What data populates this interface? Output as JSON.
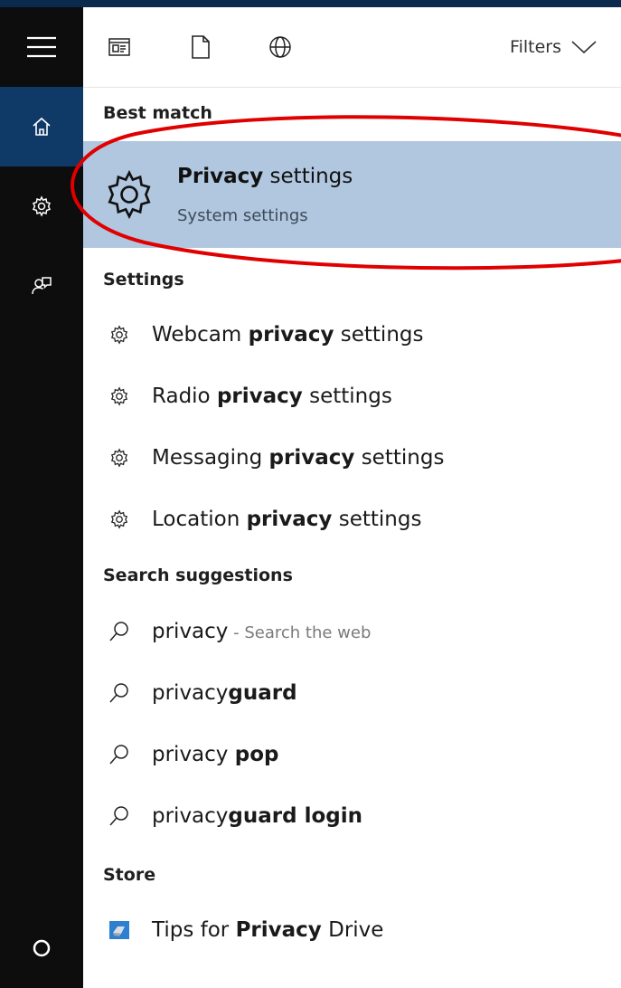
{
  "toolbar": {
    "filters_label": "Filters",
    "tab_icons": [
      "apps-icon",
      "document-icon",
      "web-globe-icon"
    ]
  },
  "sidebar": {
    "items": [
      {
        "icon": "hamburger-menu-icon"
      },
      {
        "icon": "home-icon",
        "active": true
      },
      {
        "icon": "gear-icon"
      },
      {
        "icon": "feedback-icon"
      },
      {
        "icon": "cortana-circle-icon"
      }
    ]
  },
  "sections": {
    "best_match": "Best match",
    "settings": "Settings",
    "search_suggestions": "Search suggestions",
    "store": "Store"
  },
  "best_match": {
    "title_bold": "Privacy",
    "title_rest": " settings",
    "subtitle": "System settings",
    "highlight_color": "#b0c7df"
  },
  "settings_results": [
    {
      "pre": "Webcam ",
      "bold": "privacy",
      "post": " settings"
    },
    {
      "pre": "Radio ",
      "bold": "privacy",
      "post": " settings"
    },
    {
      "pre": "Messaging ",
      "bold": "privacy",
      "post": " settings"
    },
    {
      "pre": "Location ",
      "bold": "privacy",
      "post": " settings"
    }
  ],
  "suggestions": [
    {
      "pre": "privacy",
      "bold": "",
      "post": "",
      "extra": " - Search the web"
    },
    {
      "pre": "privacy",
      "bold": "guard",
      "post": "",
      "extra": ""
    },
    {
      "pre": "privacy ",
      "bold": "pop",
      "post": "",
      "extra": ""
    },
    {
      "pre": "privacy",
      "bold": "guard login",
      "post": "",
      "extra": ""
    }
  ],
  "store_results": [
    {
      "pre": "Tips for ",
      "bold": "Privacy",
      "post": " Drive",
      "icon": "store-app-icon"
    }
  ],
  "colors": {
    "sidebar": "#0d0d0d",
    "sidebar_active": "#0f3a68",
    "annotation": "#e00000"
  }
}
